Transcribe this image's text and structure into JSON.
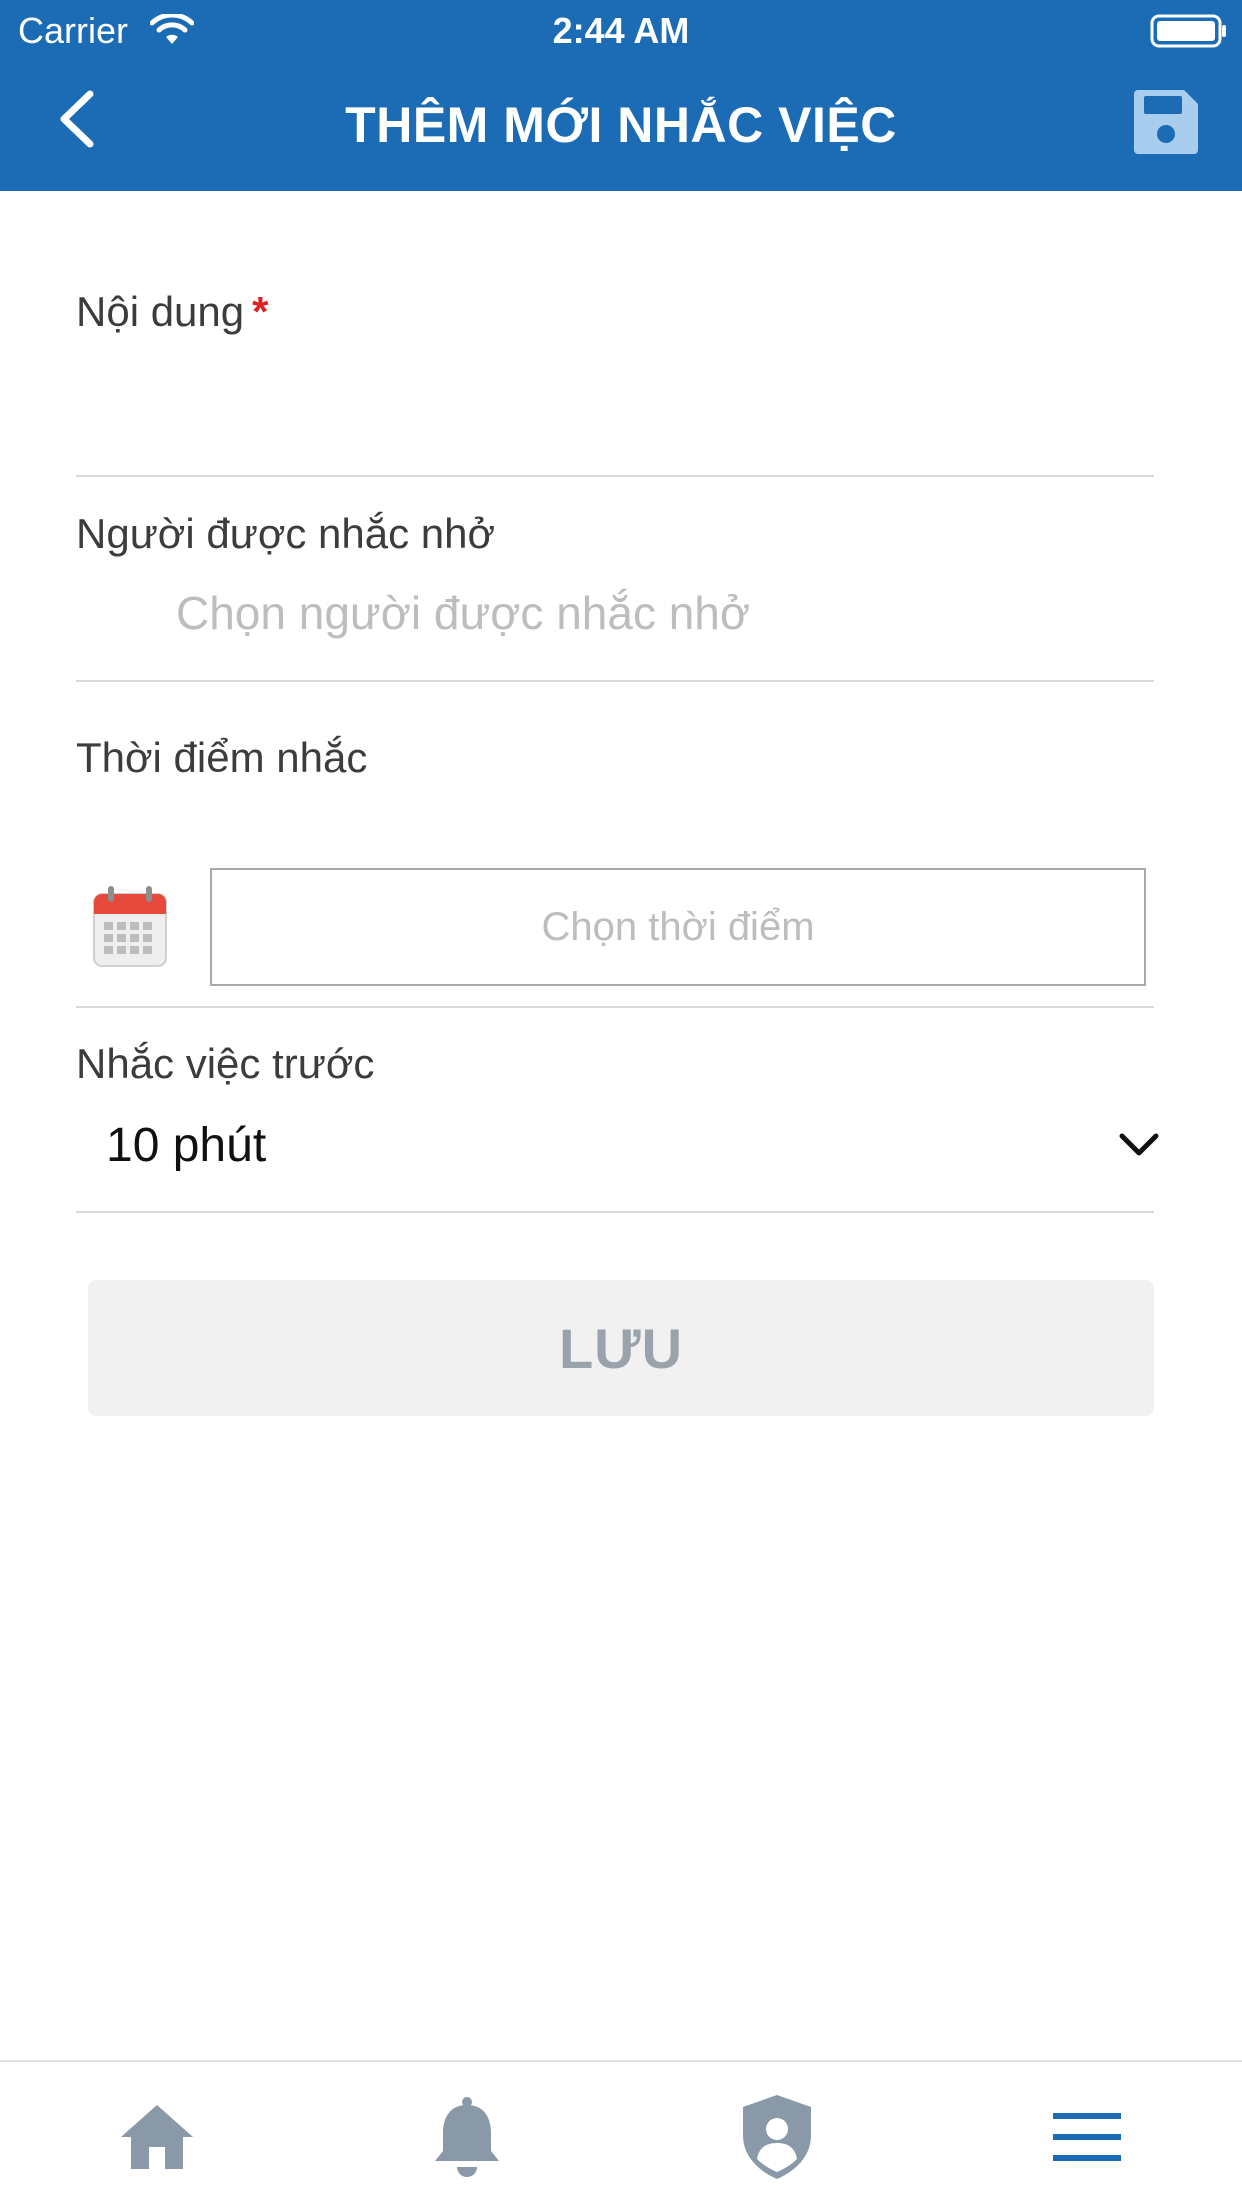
{
  "status_bar": {
    "carrier": "Carrier",
    "time": "2:44 AM"
  },
  "header": {
    "title": "THÊM MỚI NHẮC VIỆC"
  },
  "form": {
    "content": {
      "label": "Nội dung",
      "required_mark": "*",
      "value": ""
    },
    "recipient": {
      "label": "Người được nhắc nhở",
      "placeholder": "Chọn người được nhắc nhở"
    },
    "reminder_time": {
      "label": "Thời điểm nhắc",
      "placeholder": "Chọn thời điểm"
    },
    "remind_before": {
      "label": "Nhắc việc trước",
      "selected": "10 phút"
    },
    "save_button": "LƯU"
  },
  "colors": {
    "header_bg": "#1c6bb5",
    "required": "#e02020",
    "nav_inactive": "#8a99a8",
    "nav_active": "#1c6bb5"
  },
  "bottom_nav": {
    "items": [
      {
        "icon": "home-icon",
        "active": false
      },
      {
        "icon": "bell-icon",
        "active": false
      },
      {
        "icon": "shield-user-icon",
        "active": false
      },
      {
        "icon": "menu-icon",
        "active": true
      }
    ]
  }
}
